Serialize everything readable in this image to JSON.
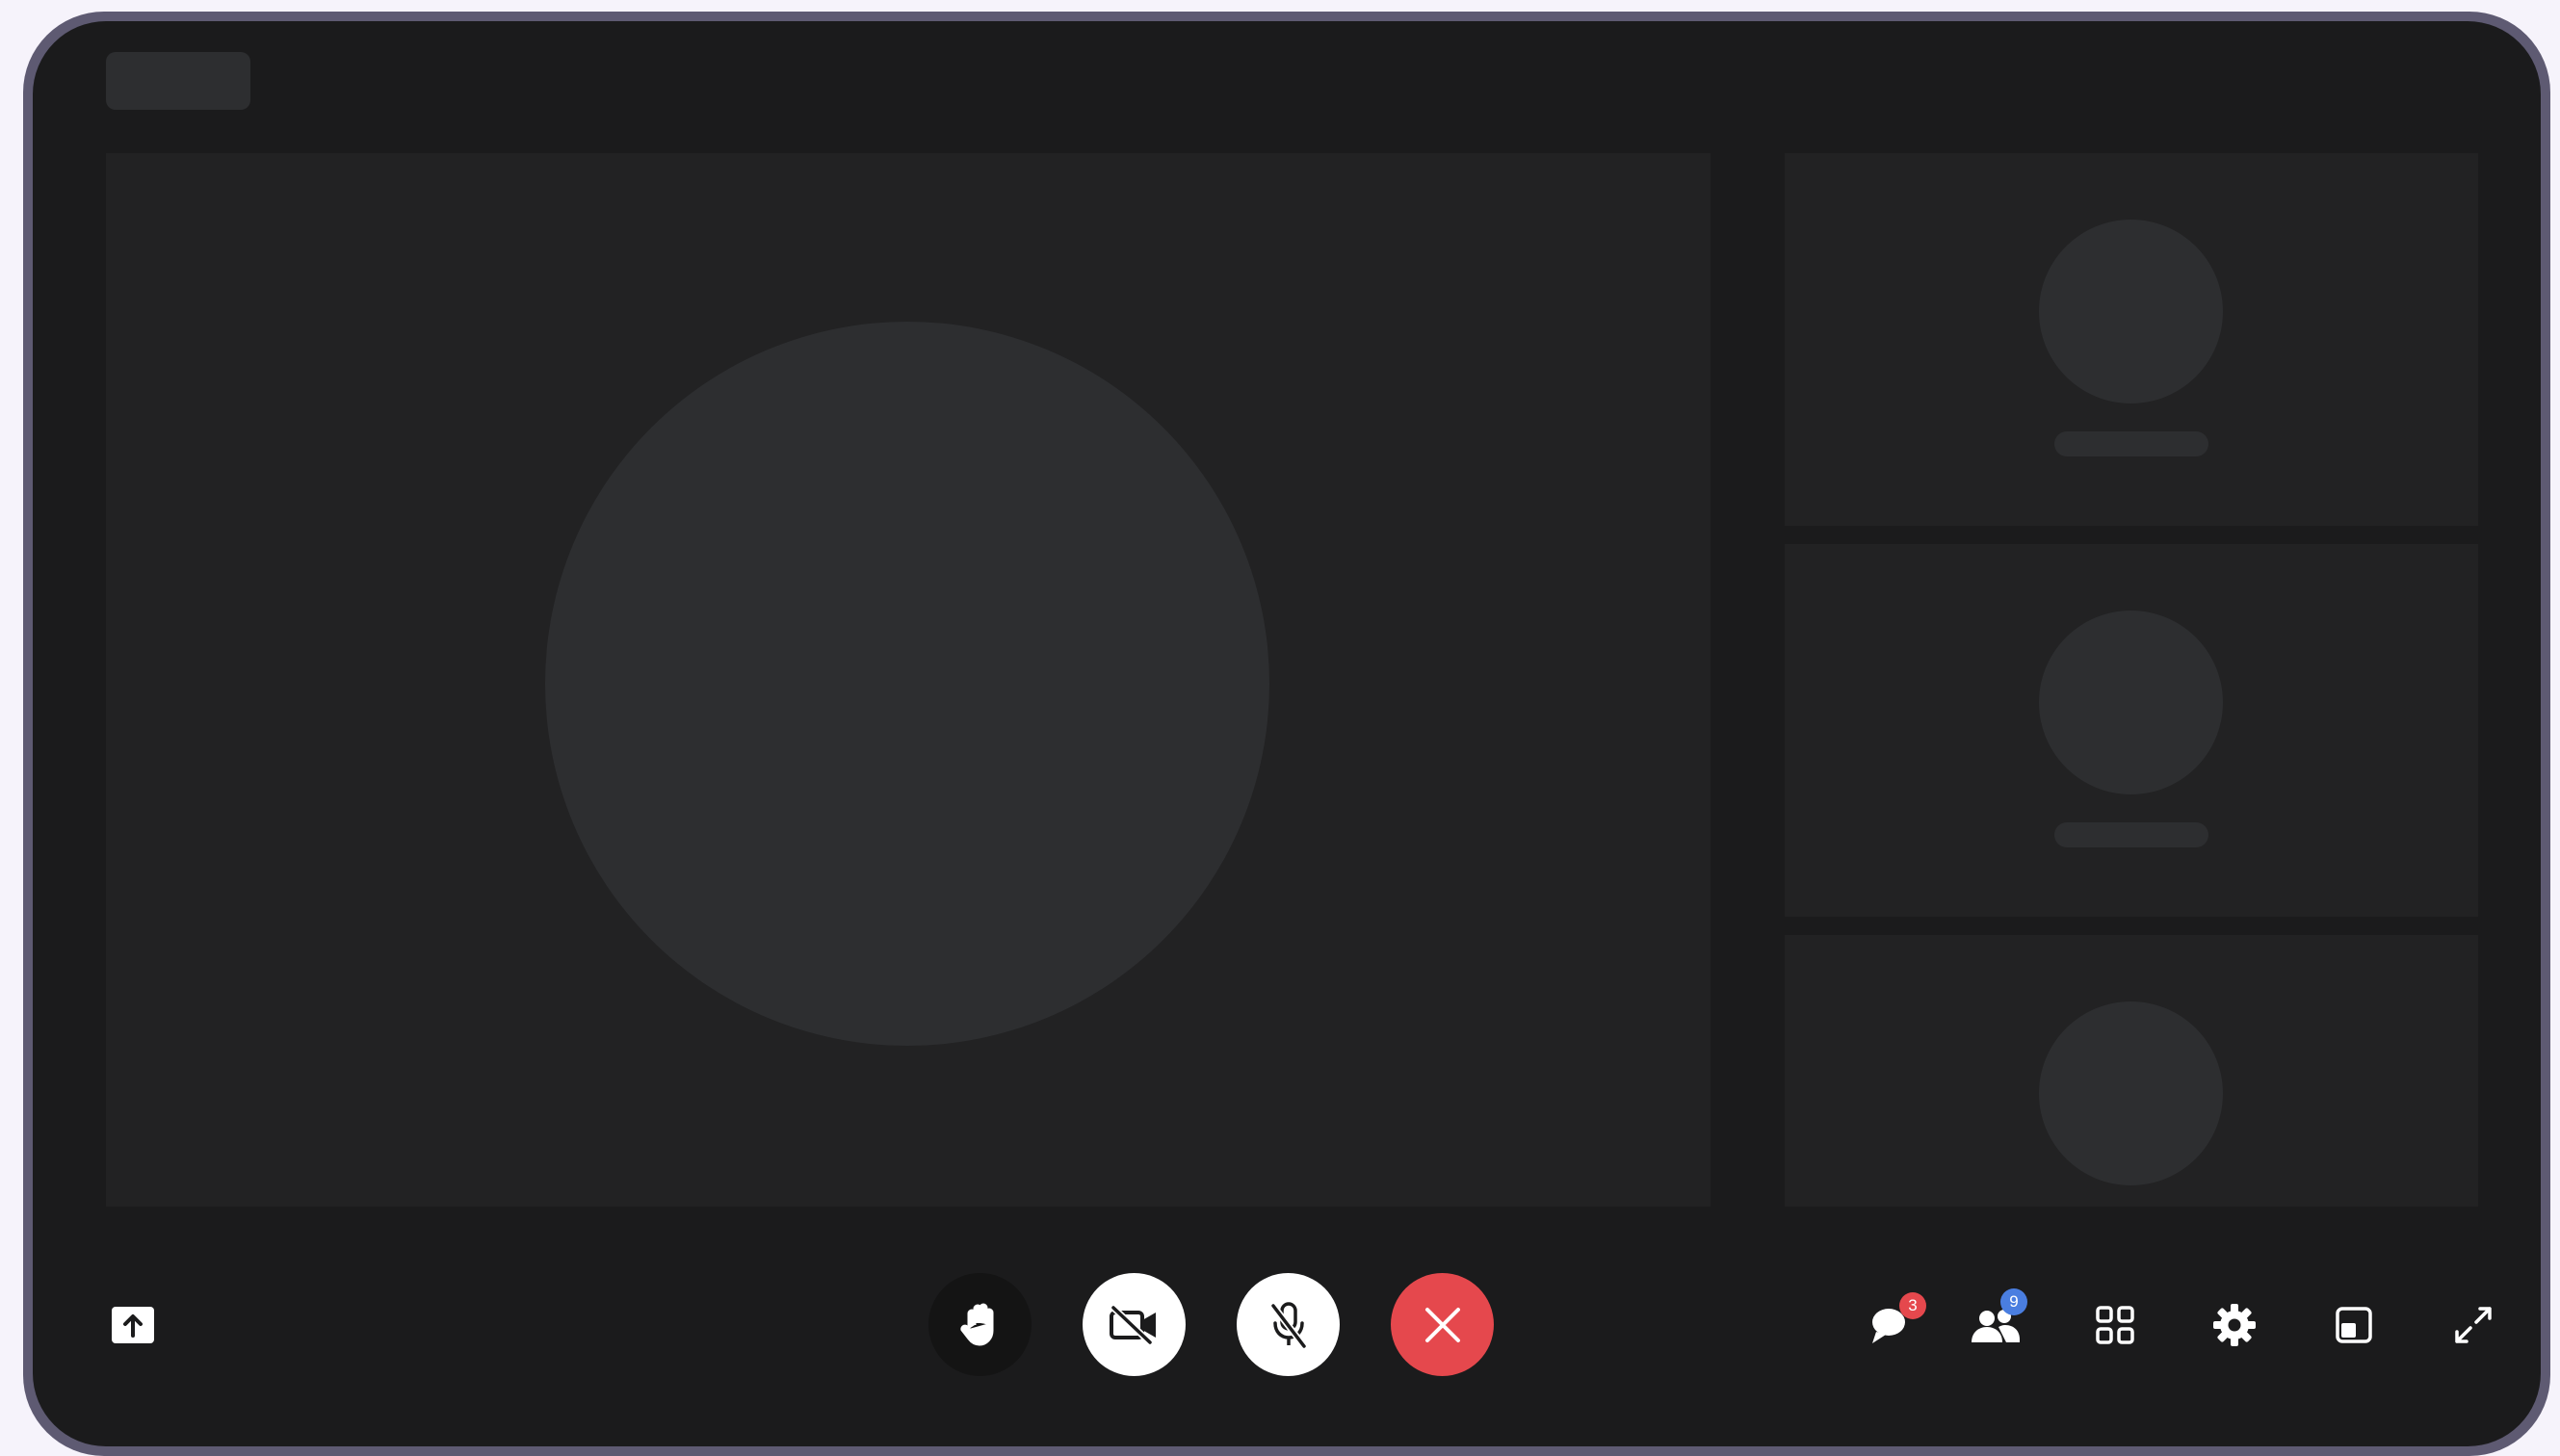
{
  "header": {
    "room_label_placeholder": ""
  },
  "stage": {
    "main_participant": {
      "name": ""
    },
    "sidebar_participants": [
      {
        "name": ""
      },
      {
        "name": ""
      },
      {
        "name": ""
      }
    ]
  },
  "toolbar": {
    "left": [
      {
        "name": "share-screen",
        "icon": "upload-arrow-icon"
      }
    ],
    "center": [
      {
        "name": "raise-hand",
        "icon": "hand-icon"
      },
      {
        "name": "camera-toggle",
        "icon": "video-off-icon",
        "state": "off"
      },
      {
        "name": "mic-toggle",
        "icon": "mic-off-icon",
        "state": "muted"
      },
      {
        "name": "end-call",
        "icon": "close-icon"
      }
    ],
    "right": [
      {
        "name": "chat",
        "icon": "chat-icon",
        "badge": "3"
      },
      {
        "name": "participants",
        "icon": "people-icon",
        "badge": "9"
      },
      {
        "name": "grid-view",
        "icon": "grid-icon"
      },
      {
        "name": "settings",
        "icon": "gear-icon"
      },
      {
        "name": "picture-in-picture",
        "icon": "pip-icon"
      },
      {
        "name": "fullscreen",
        "icon": "expand-icon"
      }
    ]
  },
  "colors": {
    "background": "#1b1b1c",
    "tile": "#222223",
    "placeholder": "#2d2e30",
    "end_call": "#e5484d",
    "chat_badge": "#e5484d",
    "participants_badge": "#4a7ee0",
    "frame": "#5e5a72"
  }
}
